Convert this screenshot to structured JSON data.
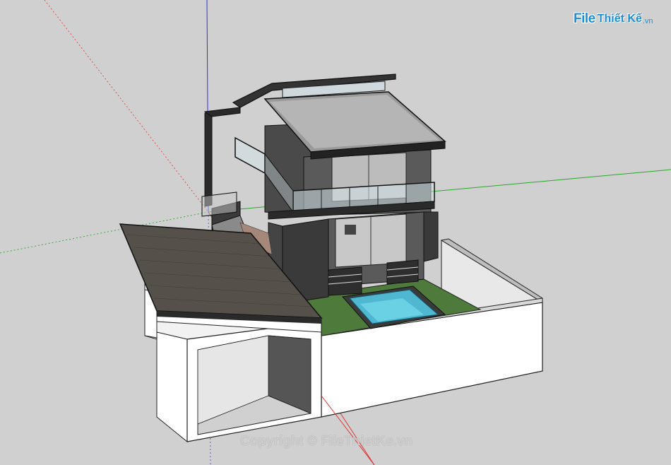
{
  "watermark": {
    "logo_file": "File",
    "logo_name": "Thiết Kế",
    "logo_suffix": ".vn",
    "copyright": "Copyright © FileThietKe.vn"
  },
  "colors": {
    "background": "#d0d0d0",
    "axis_red": "#e03030",
    "axis_green": "#2aa82a",
    "axis_blue": "#3030e0",
    "brand": "#1a8fd8",
    "pool_water": "#4fb8d0",
    "lawn": "#4e7a3c",
    "roof_shingle": "#555049",
    "wall_dark": "#3a3a3a",
    "wall_white": "#ffffff"
  },
  "scene": {
    "type": "sketchup-3d-model",
    "subject": "two-storey house with pool, carport and boundary wall"
  }
}
